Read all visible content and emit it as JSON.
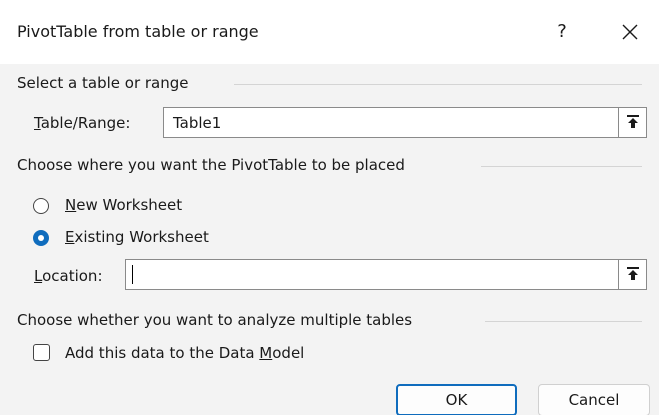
{
  "dialog": {
    "title": "PivotTable from table or range",
    "help_label": "?"
  },
  "source": {
    "section_label": "Select a table or range",
    "table_range_label_accel": "T",
    "table_range_label_rest": "able/Range:",
    "table_range_value": "Table1"
  },
  "placement": {
    "section_label": "Choose where you want the PivotTable to be placed",
    "options": [
      {
        "accel": "N",
        "rest": "ew Worksheet",
        "checked": false
      },
      {
        "accel": "E",
        "rest": "xisting Worksheet",
        "checked": true
      }
    ],
    "location_label_accel": "L",
    "location_label_rest": "ocation:",
    "location_value": ""
  },
  "multiple": {
    "section_label": "Choose whether you want to analyze multiple tables",
    "data_model_label_pre": "Add this data to the Data ",
    "data_model_label_accel": "M",
    "data_model_label_post": "odel",
    "data_model_checked": false
  },
  "buttons": {
    "ok_label": "OK",
    "cancel_label": "Cancel"
  },
  "colors": {
    "accent": "#0f6cbd",
    "background": "#f3f3f3",
    "titlebar": "#ffffff"
  }
}
